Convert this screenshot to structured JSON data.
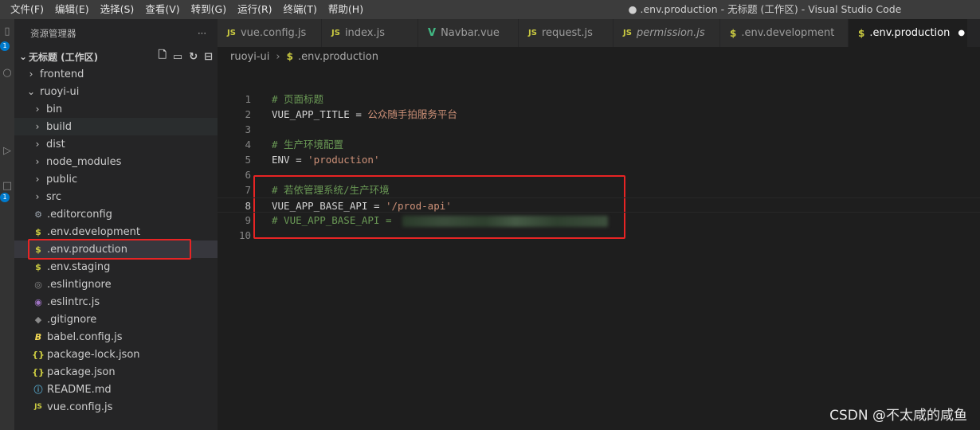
{
  "titlebar": {
    "menu": [
      "文件(F)",
      "编辑(E)",
      "选择(S)",
      "查看(V)",
      "转到(G)",
      "运行(R)",
      "终端(T)",
      "帮助(H)"
    ],
    "window_title": "● .env.production - 无标题 (工作区) - Visual Studio Code"
  },
  "activitybar": {
    "badges": [
      "1",
      "1"
    ]
  },
  "sidebar": {
    "title": "资源管理器",
    "more": "···",
    "workspace": "无标题 (工作区)",
    "items": [
      {
        "label": "frontend",
        "type": "folder",
        "depth": 0,
        "icon": "chevron-right"
      },
      {
        "label": "ruoyi-ui",
        "type": "folder-open",
        "depth": 0,
        "icon": "chevron-down"
      },
      {
        "label": "bin",
        "type": "folder",
        "depth": 1,
        "icon": "chevron-right"
      },
      {
        "label": "build",
        "type": "folder",
        "depth": 1,
        "icon": "chevron-right"
      },
      {
        "label": "dist",
        "type": "folder",
        "depth": 1,
        "icon": "chevron-right"
      },
      {
        "label": "node_modules",
        "type": "folder",
        "depth": 1,
        "icon": "chevron-right"
      },
      {
        "label": "public",
        "type": "folder",
        "depth": 1,
        "icon": "chevron-right"
      },
      {
        "label": "src",
        "type": "folder",
        "depth": 1,
        "icon": "chevron-right"
      },
      {
        "label": ".editorconfig",
        "type": "file",
        "depth": 1,
        "icon": "gear"
      },
      {
        "label": ".env.development",
        "type": "file",
        "depth": 1,
        "icon": "dollar"
      },
      {
        "label": ".env.production",
        "type": "file",
        "depth": 1,
        "icon": "dollar"
      },
      {
        "label": ".env.staging",
        "type": "file",
        "depth": 1,
        "icon": "dollar"
      },
      {
        "label": ".eslintignore",
        "type": "file",
        "depth": 1,
        "icon": "circle"
      },
      {
        "label": ".eslintrc.js",
        "type": "file",
        "depth": 1,
        "icon": "eslint"
      },
      {
        "label": ".gitignore",
        "type": "file",
        "depth": 1,
        "icon": "git"
      },
      {
        "label": "babel.config.js",
        "type": "file",
        "depth": 1,
        "icon": "babel"
      },
      {
        "label": "package-lock.json",
        "type": "file",
        "depth": 1,
        "icon": "braces"
      },
      {
        "label": "package.json",
        "type": "file",
        "depth": 1,
        "icon": "braces"
      },
      {
        "label": "README.md",
        "type": "file",
        "depth": 1,
        "icon": "info"
      },
      {
        "label": "vue.config.js",
        "type": "file",
        "depth": 1,
        "icon": "js"
      }
    ]
  },
  "tabs": [
    {
      "label": "vue.config.js",
      "icon": "JS"
    },
    {
      "label": "index.js",
      "icon": "JS"
    },
    {
      "label": "Navbar.vue",
      "icon": "V"
    },
    {
      "label": "request.js",
      "icon": "JS"
    },
    {
      "label": "permission.js",
      "icon": "JS"
    },
    {
      "label": ".env.development",
      "icon": "$"
    },
    {
      "label": ".env.production",
      "icon": "$",
      "dirty": "●"
    }
  ],
  "breadcrumb": {
    "folder": "ruoyi-ui",
    "sep": "›",
    "file": ".env.production",
    "icon": "$"
  },
  "editor": {
    "lines": [
      {
        "n": "1",
        "comment": "# 页面标题"
      },
      {
        "n": "2",
        "key": "VUE_APP_TITLE",
        "op": " = ",
        "value": "公众随手拍服务平台"
      },
      {
        "n": "3"
      },
      {
        "n": "4",
        "comment": "# 生产环境配置"
      },
      {
        "n": "5",
        "key": "ENV",
        "op": " = ",
        "value": "'production'"
      },
      {
        "n": "6"
      },
      {
        "n": "7",
        "comment": "# 若依管理系统/生产环境"
      },
      {
        "n": "8",
        "key": "VUE_APP_BASE_API",
        "op": " = ",
        "value": "'/prod-api'"
      },
      {
        "n": "9",
        "comment": "# VUE_APP_BASE_API = "
      },
      {
        "n": "10"
      }
    ]
  },
  "watermark": "CSDN @不太咸的咸鱼",
  "colors": {
    "highlight": "#e82424",
    "accent": "#007acc"
  }
}
